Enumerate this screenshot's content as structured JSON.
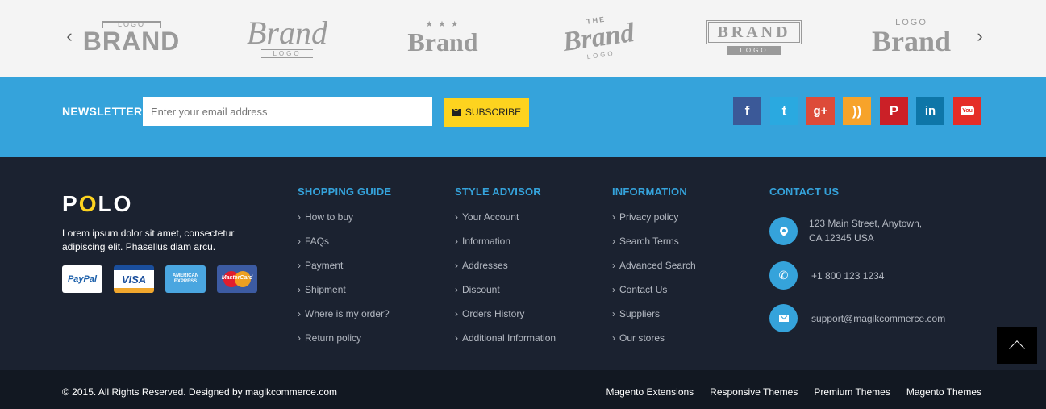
{
  "brands": {
    "prev_arrow": "‹",
    "next_arrow": "›",
    "logos": [
      {
        "top": "LOGO",
        "main": "BRAND",
        "sub": ""
      },
      {
        "top": "",
        "main": "Brand",
        "sub": "LOGO"
      },
      {
        "top": "★ ★ ★",
        "main": "Brand",
        "sub": ""
      },
      {
        "top": "THE",
        "main": "Brand",
        "sub": "LOGO"
      },
      {
        "top": "",
        "main": "BRAND",
        "sub": "LOGO"
      },
      {
        "top": "LOGO",
        "main": "Brand",
        "sub": ""
      }
    ]
  },
  "newsletter": {
    "label": "NEWSLETTER",
    "placeholder": "Enter your email address",
    "button_label": "SUBSCRIBE"
  },
  "social": {
    "facebook": "f",
    "twitter": "t",
    "googleplus": "g+",
    "rss": "))",
    "pinterest": "P",
    "linkedin": "in",
    "youtube": "You"
  },
  "footer": {
    "logo_p": "P",
    "logo_o": "O",
    "logo_lo": "LO",
    "about": "Lorem ipsum dolor sit amet, consectetur adipiscing elit. Phasellus diam arcu.",
    "cards": {
      "paypal": "PayPal",
      "visa": "VISA",
      "amex": "AMERICAN EXPRESS",
      "mastercard": "MasterCard"
    },
    "columns": [
      {
        "title": "SHOPPING GUIDE",
        "links": [
          "How to buy",
          "FAQs",
          "Payment",
          "Shipment",
          "Where is my order?",
          "Return policy"
        ]
      },
      {
        "title": "STYLE ADVISOR",
        "links": [
          "Your Account",
          "Information",
          "Addresses",
          "Discount",
          "Orders History",
          "Additional Information"
        ]
      },
      {
        "title": "INFORMATION",
        "links": [
          "Privacy policy",
          "Search Terms",
          "Advanced Search",
          "Contact Us",
          "Suppliers",
          "Our stores"
        ]
      }
    ],
    "contact": {
      "title": "CONTACT US",
      "address_line1": "123 Main Street, Anytown,",
      "address_line2": "CA 12345 USA",
      "phone": "+1 800 123 1234",
      "email": "support@magikcommerce.com"
    },
    "chevron": "›"
  },
  "bottom": {
    "copyright": "© 2015. All Rights Reserved. Designed by magikcommerce.com",
    "links": [
      "Magento Extensions",
      "Responsive Themes",
      "Premium Themes",
      "Magento Themes"
    ]
  },
  "colors": {
    "accent_blue": "#35a3db",
    "accent_yellow": "#fdd31f",
    "footer_bg": "#1b2230",
    "bottom_bg": "#121822"
  }
}
